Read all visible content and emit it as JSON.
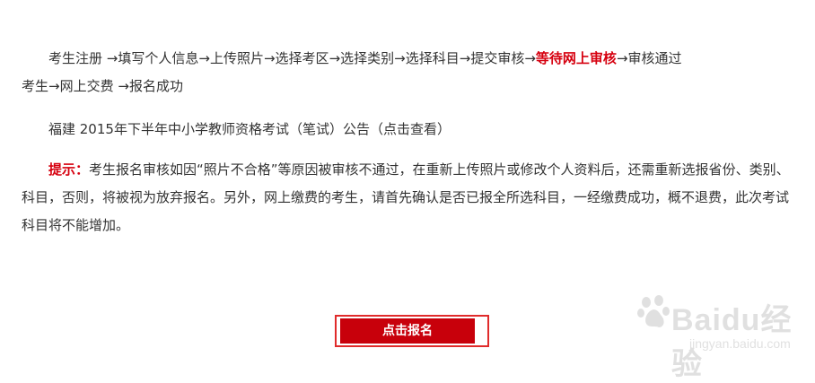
{
  "steps": {
    "items": [
      {
        "label": "考生注册 ",
        "arrow": "→"
      },
      {
        "label": "填写个人信息",
        "arrow": "→"
      },
      {
        "label": "上传照片",
        "arrow": "→"
      },
      {
        "label": "选择考区",
        "arrow": "→"
      },
      {
        "label": "选择类别",
        "arrow": "→"
      },
      {
        "label": "选择科目",
        "arrow": "→"
      },
      {
        "label": "提交审核",
        "arrow": "→"
      },
      {
        "label": "等待网上审核",
        "arrow": "→",
        "highlight": true
      },
      {
        "label": "审核通过",
        "arrow": ""
      },
      {
        "label": "考生",
        "arrow": "→"
      },
      {
        "label": "网上交费 ",
        "arrow": "→"
      },
      {
        "label": "报名成功",
        "arrow": ""
      }
    ]
  },
  "announcement": {
    "text": "福建  2015年下半年中小学教师资格考试（笔试）公告（点击查看）"
  },
  "notice": {
    "label": "提示：",
    "text": "考生报名审核如因“照片不合格”等原因被审核不通过，在重新上传照片或修改个人资料后，还需重新选报省份、类别、科目，否则，将被视为放弃报名。另外，网上缴费的考生，请首先确认是否已报全所选科目，一经缴费成功，概不退费，此次考试科目将不能增加。"
  },
  "register_button": {
    "label": "点击报名"
  },
  "watermark": {
    "brand": "Baidu经验",
    "url": "jingyan.baidu.com"
  },
  "colors": {
    "accent": "#d6000f",
    "button_bg": "#c8000b",
    "text": "#333333"
  }
}
